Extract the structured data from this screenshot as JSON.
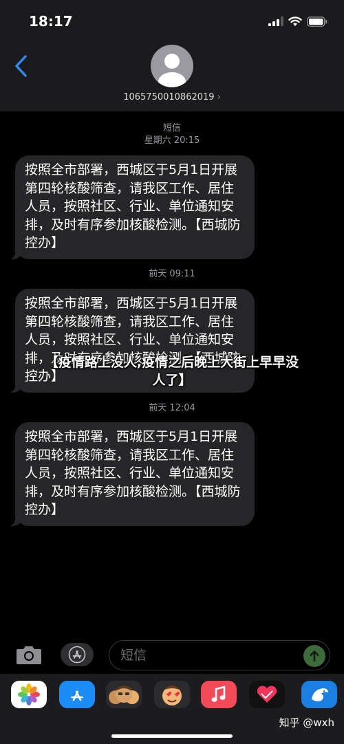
{
  "status": {
    "time": "18:17"
  },
  "header": {
    "contact": "1065750010862019",
    "chevron": "›"
  },
  "messages": [
    {
      "stamp_label": "短信",
      "stamp_time": "星期六 20:15",
      "text": "按照全市部署，西城区于5月1日开展第四轮核酸筛查，请我区工作、居住人员，按照社区、行业、单位通知安排，及时有序参加核酸检测。【西城防控办】"
    },
    {
      "stamp_time": "前天 09:11",
      "text": "按照全市部署，西城区于5月1日开展第四轮核酸筛查，请我区工作、居住人员，按照社区、行业、单位通知安排，及时有序参加核酸检测。【西城防控办】"
    },
    {
      "stamp_time": "前天 12:04",
      "text": "按照全市部署，西城区于5月1日开展第四轮核酸筛查，请我区工作、居住人员，按照社区、行业、单位通知安排，及时有序参加核酸检测。【西城防控办】"
    }
  ],
  "overlay_title": "【疫情路上没人,疫情之后晚上大街上早早没人了】",
  "input": {
    "placeholder": "短信"
  },
  "watermark": "知乎 @wxh",
  "colors": {
    "bubble": "#262629",
    "header": "#1b1b1d",
    "send": "#3d6b3b"
  }
}
